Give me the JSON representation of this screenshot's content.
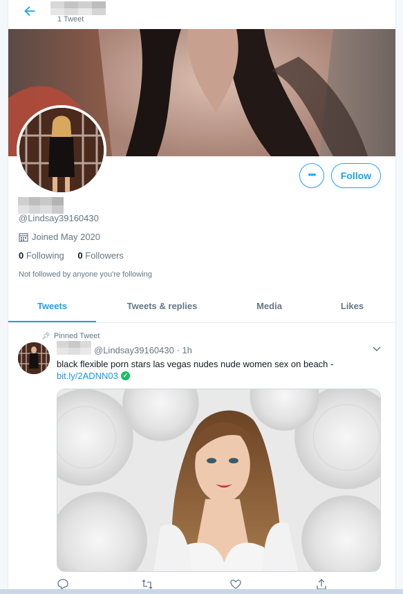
{
  "header": {
    "tweet_count": "1 Tweet"
  },
  "profile": {
    "handle": "@Lindsay39160430",
    "joined": "Joined May 2020",
    "following_count": "0",
    "following_label": "Following",
    "followers_count": "0",
    "followers_label": "Followers",
    "not_followed": "Not followed by anyone you're following",
    "more_label": "•••",
    "follow_label": "Follow"
  },
  "tabs": [
    {
      "label": "Tweets",
      "active": true
    },
    {
      "label": "Tweets & replies",
      "active": false
    },
    {
      "label": "Media",
      "active": false
    },
    {
      "label": "Likes",
      "active": false
    }
  ],
  "tweet": {
    "pinned_label": "Pinned Tweet",
    "meta": "@Lindsay39160430 · 1h",
    "text": "black flexible porn stars las vegas nudes nude women sex on beach -",
    "link": "bit.ly/2ADNN03"
  },
  "icons": {
    "back": "arrow-left-icon",
    "more": "more-icon",
    "calendar": "calendar-icon",
    "pin": "pin-icon",
    "caret": "chevron-down-icon",
    "verified": "verified-check-icon",
    "reply": "reply-icon",
    "retweet": "retweet-icon",
    "like": "heart-icon",
    "share": "share-icon"
  },
  "colors": {
    "accent": "#1da1f2",
    "link": "#1b95e0",
    "muted": "#657786",
    "verified": "#17bf63"
  }
}
